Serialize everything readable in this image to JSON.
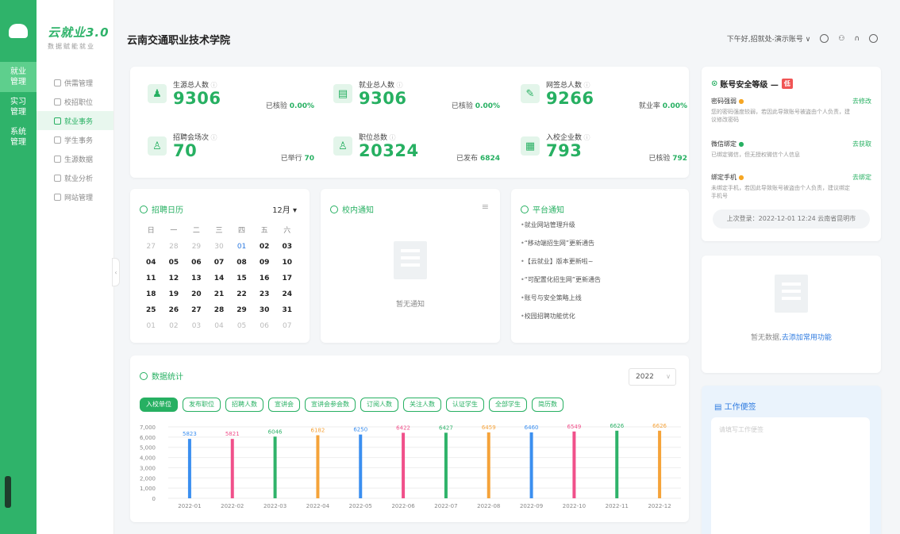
{
  "rail": {
    "items": [
      {
        "line1": "就业",
        "line2": "管理"
      },
      {
        "line1": "实习",
        "line2": "管理"
      },
      {
        "line1": "系统",
        "line2": "管理"
      }
    ]
  },
  "brand": {
    "title": "云就业3.0",
    "subtitle": "数据赋能就业"
  },
  "sidebar": {
    "items": [
      {
        "label": "供需管理"
      },
      {
        "label": "校招职位"
      },
      {
        "label": "就业事务"
      },
      {
        "label": "学生事务"
      },
      {
        "label": "生源数据"
      },
      {
        "label": "就业分析"
      },
      {
        "label": "网站管理"
      }
    ]
  },
  "header": {
    "school": "云南交通职业技术学院",
    "greeting": "下午好,招就处-演示账号 ∨"
  },
  "stats": [
    {
      "label": "生源总人数",
      "value": "9306",
      "sub_label": "已核验",
      "sub_value": "0.00%",
      "icon": "graduate-icon"
    },
    {
      "label": "就业总人数",
      "value": "9306",
      "sub_label": "已核验",
      "sub_value": "0.00%",
      "icon": "briefcase-icon"
    },
    {
      "label": "网签总人数",
      "value": "9266",
      "sub_label": "就业率",
      "sub_value": "0.00%",
      "icon": "contract-icon"
    },
    {
      "label": "招聘会场次",
      "value": "70",
      "sub_label": "已举行",
      "sub_value": "70",
      "icon": "people-icon"
    },
    {
      "label": "职位总数",
      "value": "20324",
      "sub_label": "已发布",
      "sub_value": "6824",
      "icon": "user-icon"
    },
    {
      "label": "入校企业数",
      "value": "793",
      "sub_label": "已核验",
      "sub_value": "792",
      "icon": "building-icon"
    }
  ],
  "calendar": {
    "title": "招聘日历",
    "month": "12月 ▾",
    "weekdays": [
      "日",
      "一",
      "二",
      "三",
      "四",
      "五",
      "六"
    ],
    "days": [
      {
        "d": "27",
        "t": "cm"
      },
      {
        "d": "28",
        "t": "cm"
      },
      {
        "d": "29",
        "t": "cm"
      },
      {
        "d": "30",
        "t": "cm"
      },
      {
        "d": "01",
        "t": "ct"
      },
      {
        "d": "02",
        "t": "cd"
      },
      {
        "d": "03",
        "t": "cd"
      },
      {
        "d": "04",
        "t": "cd"
      },
      {
        "d": "05",
        "t": "cd"
      },
      {
        "d": "06",
        "t": "cd"
      },
      {
        "d": "07",
        "t": "cd"
      },
      {
        "d": "08",
        "t": "cd"
      },
      {
        "d": "09",
        "t": "cd"
      },
      {
        "d": "10",
        "t": "cd"
      },
      {
        "d": "11",
        "t": "cd"
      },
      {
        "d": "12",
        "t": "cd"
      },
      {
        "d": "13",
        "t": "cd"
      },
      {
        "d": "14",
        "t": "cd"
      },
      {
        "d": "15",
        "t": "cd"
      },
      {
        "d": "16",
        "t": "cd"
      },
      {
        "d": "17",
        "t": "cd"
      },
      {
        "d": "18",
        "t": "cd"
      },
      {
        "d": "19",
        "t": "cd"
      },
      {
        "d": "20",
        "t": "cd"
      },
      {
        "d": "21",
        "t": "cd"
      },
      {
        "d": "22",
        "t": "cd"
      },
      {
        "d": "23",
        "t": "cd"
      },
      {
        "d": "24",
        "t": "cd"
      },
      {
        "d": "25",
        "t": "cd"
      },
      {
        "d": "26",
        "t": "cd"
      },
      {
        "d": "27",
        "t": "cd"
      },
      {
        "d": "28",
        "t": "cd"
      },
      {
        "d": "29",
        "t": "cd"
      },
      {
        "d": "30",
        "t": "cd"
      },
      {
        "d": "31",
        "t": "cd"
      },
      {
        "d": "01",
        "t": "cm"
      },
      {
        "d": "02",
        "t": "cm"
      },
      {
        "d": "03",
        "t": "cm"
      },
      {
        "d": "04",
        "t": "cm"
      },
      {
        "d": "05",
        "t": "cm"
      },
      {
        "d": "06",
        "t": "cm"
      },
      {
        "d": "07",
        "t": "cm"
      }
    ]
  },
  "campus_notice": {
    "title": "校内通知",
    "empty": "暂无通知"
  },
  "platform_notice": {
    "title": "平台通知",
    "items": [
      "就业网站管理升级",
      "“移动端招生网”更新通告",
      "【云就业】版本更新啦~",
      "“可配置化招生网”更新通告",
      "账号与安全策略上线",
      "校园招聘功能优化"
    ]
  },
  "data_stats": {
    "title": "数据统计",
    "year": "2022",
    "tabs": [
      "入校单位",
      "发布职位",
      "招聘人数",
      "宣讲会",
      "宣讲会参会数",
      "订阅人数",
      "关注人数",
      "认证学生",
      "全部学生",
      "简历数"
    ]
  },
  "chart_data": {
    "type": "bar",
    "categories": [
      "2022-01",
      "2022-02",
      "2022-03",
      "2022-04",
      "2022-05",
      "2022-06",
      "2022-07",
      "2022-08",
      "2022-09",
      "2022-10",
      "2022-11",
      "2022-12"
    ],
    "values": [
      5823,
      5821,
      6046,
      6182,
      6250,
      6422,
      6427,
      6459,
      6460,
      6549,
      6626,
      6626
    ],
    "colors": [
      "#3b8ff0",
      "#f0508a",
      "#2fb36a",
      "#f5a33a",
      "#3b8ff0",
      "#f0508a",
      "#2fb36a",
      "#f5a33a",
      "#3b8ff0",
      "#f0508a",
      "#2fb36a",
      "#f5a33a"
    ],
    "yticks": [
      0,
      1000,
      2000,
      3000,
      4000,
      5000,
      6000,
      7000
    ],
    "ytick_labels": [
      "0",
      "1,000",
      "2,000",
      "3,000",
      "4,000",
      "5,000",
      "6,000",
      "7,000"
    ],
    "ylim": [
      0,
      7000
    ],
    "grid": true
  },
  "security": {
    "title": "账号安全等级 —",
    "level": "低",
    "items": [
      {
        "name": "密码强弱",
        "desc": "您的密码强度较弱，若因此导致账号被盗由个人负责，建议修改密码",
        "action": "去修改",
        "state": "warn"
      },
      {
        "name": "微信绑定",
        "desc": "已绑定微信，但无授权微信个人信息",
        "action": "去获取",
        "state": "ok"
      },
      {
        "name": "绑定手机",
        "desc": "未绑定手机，若因此导致账号被盗由个人负责，建议绑定手机号",
        "action": "去绑定",
        "state": "warn"
      }
    ],
    "last_login": "上次登录：2022-12-01 12:24 云南省昆明市"
  },
  "quick_links": {
    "empty_prefix": "暂无数据,",
    "empty_link": "去添加常用功能"
  },
  "memo": {
    "title": "工作便签",
    "placeholder": "请填写工作便签"
  }
}
